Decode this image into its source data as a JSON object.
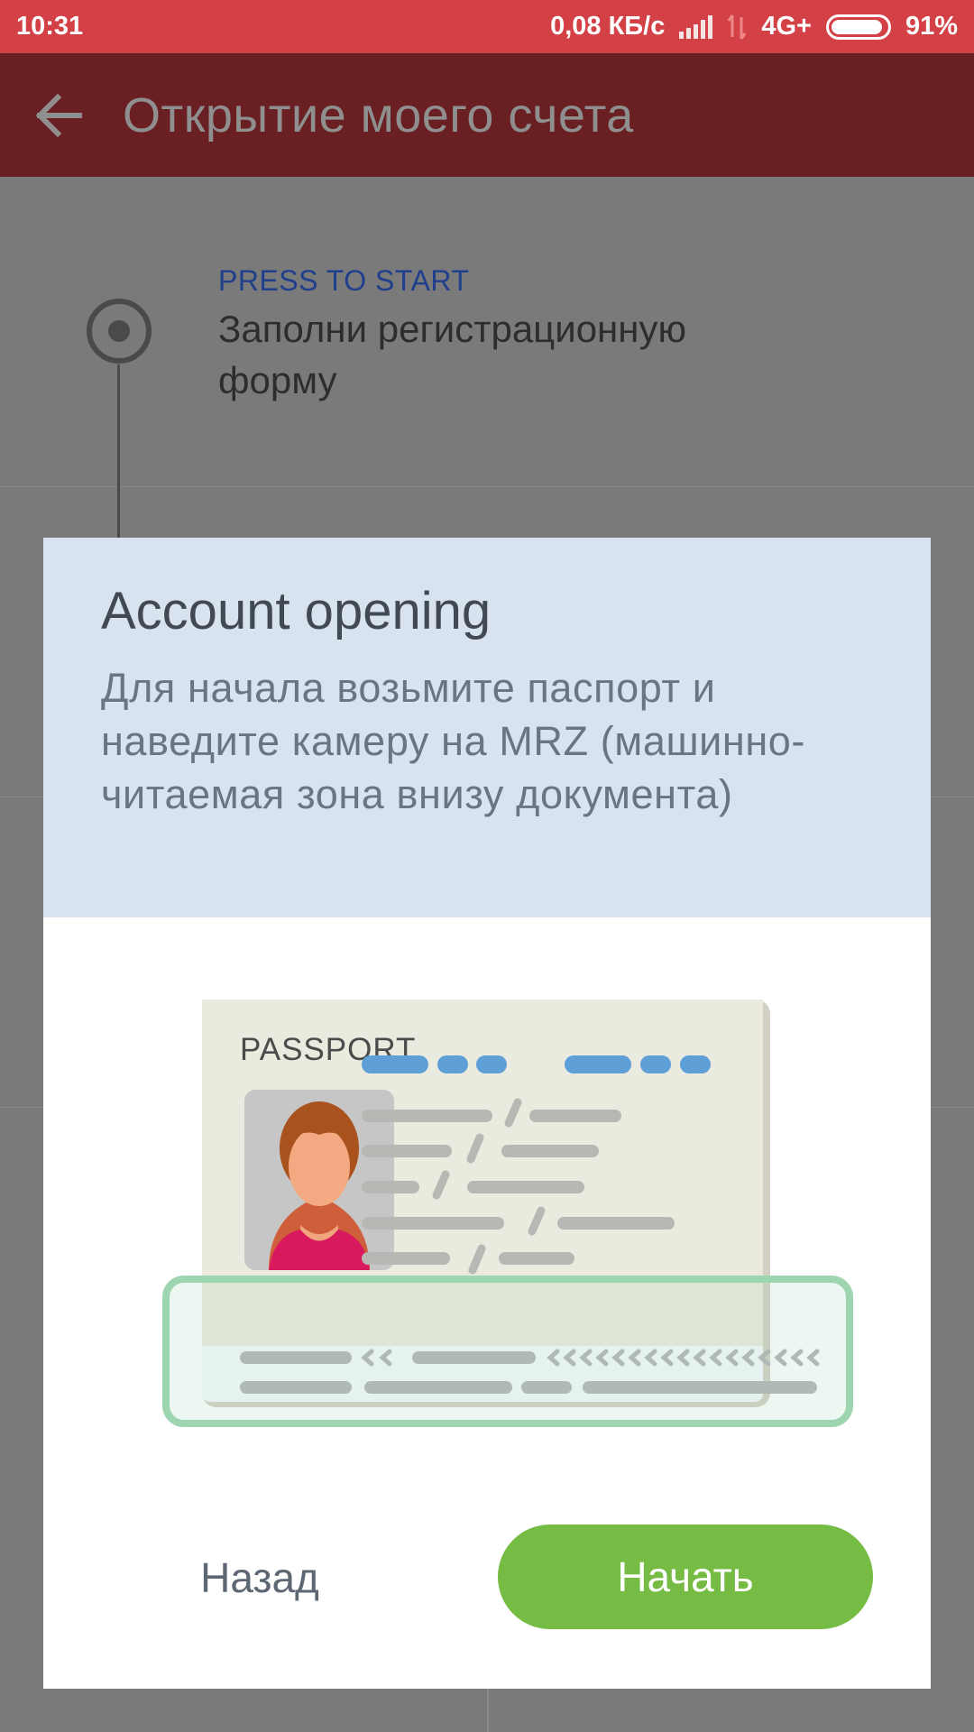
{
  "status_bar": {
    "time": "10:31",
    "speed": "0,08 КБ/с",
    "network": "4G+",
    "battery": "91%"
  },
  "app_bar": {
    "title": "Открытие моего счета",
    "back_icon": "arrow-left-icon"
  },
  "steps": [
    {
      "hint": "PRESS TO START",
      "label": "Заполни регистрационную форму"
    }
  ],
  "dialog": {
    "title": "Account opening",
    "body": "Для начала возьмите паспорт и наведите камеру на MRZ (машинно-читаемая зона внизу документа)",
    "illustration": {
      "label": "PASSPORT",
      "mrz_highlight_color": "#9dd5b0"
    },
    "back_button": "Назад",
    "start_button": "Начать"
  },
  "colors": {
    "status_bar": "#d34146",
    "app_bar": "#6a1f22",
    "accent_green": "#76bb43",
    "hint_blue": "#1f3e8c"
  }
}
